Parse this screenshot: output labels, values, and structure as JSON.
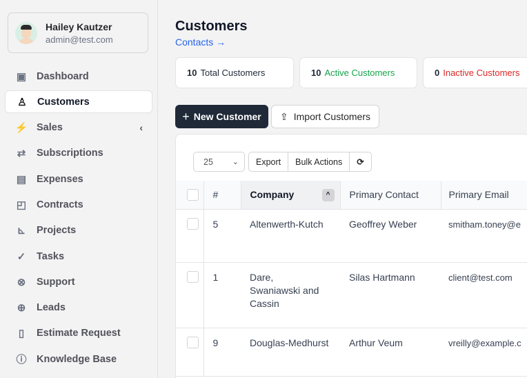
{
  "user": {
    "name": "Hailey Kautzer",
    "email": "admin@test.com"
  },
  "nav": [
    {
      "label": "Dashboard",
      "icon": "dashboard-icon"
    },
    {
      "label": "Customers",
      "icon": "user-icon",
      "active": true
    },
    {
      "label": "Sales",
      "icon": "bolt-icon"
    },
    {
      "label": "Subscriptions",
      "icon": "repeat-icon"
    },
    {
      "label": "Expenses",
      "icon": "document-icon"
    },
    {
      "label": "Contracts",
      "icon": "note-icon"
    },
    {
      "label": "Projects",
      "icon": "chart-icon"
    },
    {
      "label": "Tasks",
      "icon": "check-circle-icon"
    },
    {
      "label": "Support",
      "icon": "lifebuoy-icon"
    },
    {
      "label": "Leads",
      "icon": "crosshair-icon"
    },
    {
      "label": "Estimate Request",
      "icon": "file-icon"
    },
    {
      "label": "Knowledge Base",
      "icon": "question-icon"
    }
  ],
  "page": {
    "title": "Customers",
    "breadcrumb": "Contacts →"
  },
  "stats": [
    {
      "count": "10",
      "label": "Total Customers",
      "color": "#27272a"
    },
    {
      "count": "10",
      "label": "Active Customers",
      "color": "#16a34a"
    },
    {
      "count": "0",
      "label": "Inactive Customers",
      "color": "#dc2626"
    }
  ],
  "actions": {
    "new": "New Customer",
    "import": "Import Customers"
  },
  "toolbar": {
    "per_page": "25",
    "export": "Export",
    "bulk": "Bulk Actions"
  },
  "table": {
    "headers": [
      "#",
      "Company",
      "Primary Contact",
      "Primary Email"
    ],
    "rows": [
      {
        "id": "5",
        "company": "Altenwerth-Kutch",
        "contact": "Geoffrey Weber",
        "email": "smitham.toney@e"
      },
      {
        "id": "1",
        "company": "Dare, Swaniawski and Cassin",
        "contact": "Silas Hartmann",
        "email": "client@test.com"
      },
      {
        "id": "9",
        "company": "Douglas-Medhurst",
        "contact": "Arthur Veum",
        "email": "vreilly@example.c"
      }
    ]
  }
}
